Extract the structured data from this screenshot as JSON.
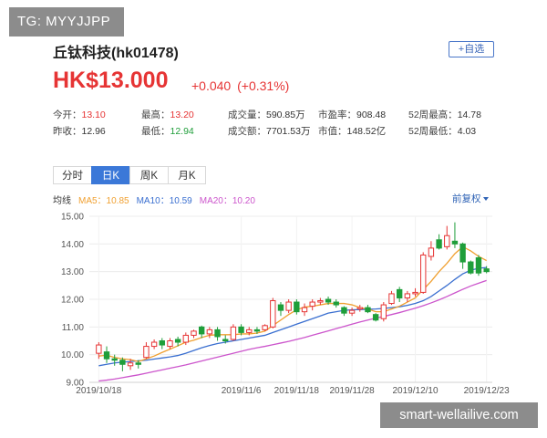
{
  "watermark_top": "TG: MYYJJPP",
  "watermark_bottom": "smart-wellailive.com",
  "stock": {
    "name": "丘钛科技(hk01478)",
    "add_label": "+自选",
    "price": "HK$13.000",
    "change": "+0.040",
    "change_pct": "(+0.31%)"
  },
  "stats": [
    [
      {
        "label": "今开：",
        "value": "13.10",
        "color": "red"
      },
      {
        "label": "最高：",
        "value": "13.20",
        "color": "red"
      },
      {
        "label": "成交量：",
        "value": "590.85万",
        "color": ""
      },
      {
        "label": "市盈率：",
        "value": "908.48",
        "color": ""
      },
      {
        "label": "52周最高：",
        "value": "14.78",
        "color": ""
      }
    ],
    [
      {
        "label": "昨收：",
        "value": "12.96",
        "color": ""
      },
      {
        "label": "最低：",
        "value": "12.94",
        "color": "green"
      },
      {
        "label": "成交额：",
        "value": "7701.53万",
        "color": ""
      },
      {
        "label": "市值：",
        "value": "148.52亿",
        "color": ""
      },
      {
        "label": "52周最低：",
        "value": "4.03",
        "color": ""
      }
    ]
  ],
  "tabs": [
    {
      "label": "分时",
      "active": false
    },
    {
      "label": "日K",
      "active": true
    },
    {
      "label": "周K",
      "active": false
    },
    {
      "label": "月K",
      "active": false
    }
  ],
  "ma": {
    "avg_label": "均线",
    "ma5": "MA5：10.85",
    "ma10": "MA10：10.59",
    "ma20": "MA20：10.20"
  },
  "adjust_label": "前复权",
  "colors": {
    "up": "#e63434",
    "down": "#1f9e3a",
    "ma5": "#f0a030",
    "ma10": "#3a6fd0",
    "ma20": "#cc55cc",
    "accent": "#3b78d8"
  },
  "chart_data": {
    "type": "candlestick",
    "ylim": [
      9.0,
      15.0
    ],
    "y_ticks": [
      "15.00",
      "14.00",
      "13.00",
      "12.00",
      "11.00",
      "10.00",
      "9.00"
    ],
    "x_ticks": [
      "2019/10/18",
      "2019/11/6",
      "2019/11/18",
      "2019/11/28",
      "2019/12/10",
      "2019/12/23"
    ],
    "candles": [
      {
        "o": 10.05,
        "c": 10.35,
        "h": 10.45,
        "l": 9.85
      },
      {
        "o": 10.1,
        "c": 9.85,
        "h": 10.3,
        "l": 9.7
      },
      {
        "o": 9.85,
        "c": 9.8,
        "h": 10.0,
        "l": 9.6
      },
      {
        "o": 9.8,
        "c": 9.65,
        "h": 9.9,
        "l": 9.4
      },
      {
        "o": 9.6,
        "c": 9.7,
        "h": 9.85,
        "l": 9.45
      },
      {
        "o": 9.7,
        "c": 9.65,
        "h": 9.8,
        "l": 9.5
      },
      {
        "o": 9.9,
        "c": 10.3,
        "h": 10.45,
        "l": 9.85
      },
      {
        "o": 10.3,
        "c": 10.45,
        "h": 10.55,
        "l": 10.2
      },
      {
        "o": 10.5,
        "c": 10.35,
        "h": 10.6,
        "l": 10.2
      },
      {
        "o": 10.3,
        "c": 10.5,
        "h": 10.6,
        "l": 10.2
      },
      {
        "o": 10.55,
        "c": 10.45,
        "h": 10.65,
        "l": 10.3
      },
      {
        "o": 10.45,
        "c": 10.7,
        "h": 10.8,
        "l": 10.35
      },
      {
        "o": 10.7,
        "c": 10.85,
        "h": 10.9,
        "l": 10.6
      },
      {
        "o": 11.0,
        "c": 10.75,
        "h": 11.05,
        "l": 10.6
      },
      {
        "o": 10.75,
        "c": 10.9,
        "h": 11.0,
        "l": 10.6
      },
      {
        "o": 10.9,
        "c": 10.65,
        "h": 11.0,
        "l": 10.5
      },
      {
        "o": 10.55,
        "c": 10.5,
        "h": 10.7,
        "l": 10.4
      },
      {
        "o": 10.55,
        "c": 11.0,
        "h": 11.1,
        "l": 10.5
      },
      {
        "o": 11.0,
        "c": 10.8,
        "h": 11.1,
        "l": 10.7
      },
      {
        "o": 10.8,
        "c": 10.9,
        "h": 11.0,
        "l": 10.7
      },
      {
        "o": 10.9,
        "c": 10.85,
        "h": 11.0,
        "l": 10.75
      },
      {
        "o": 10.9,
        "c": 11.05,
        "h": 11.1,
        "l": 10.85
      },
      {
        "o": 11.0,
        "c": 11.95,
        "h": 12.05,
        "l": 10.95
      },
      {
        "o": 11.8,
        "c": 11.6,
        "h": 11.9,
        "l": 11.4
      },
      {
        "o": 11.6,
        "c": 11.9,
        "h": 12.0,
        "l": 11.5
      },
      {
        "o": 11.9,
        "c": 11.55,
        "h": 12.0,
        "l": 11.45
      },
      {
        "o": 11.55,
        "c": 11.7,
        "h": 11.85,
        "l": 11.4
      },
      {
        "o": 11.75,
        "c": 11.9,
        "h": 12.0,
        "l": 11.6
      },
      {
        "o": 11.9,
        "c": 11.95,
        "h": 12.05,
        "l": 11.8
      },
      {
        "o": 12.0,
        "c": 11.9,
        "h": 12.1,
        "l": 11.8
      },
      {
        "o": 11.9,
        "c": 11.8,
        "h": 12.0,
        "l": 11.7
      },
      {
        "o": 11.7,
        "c": 11.5,
        "h": 11.75,
        "l": 11.4
      },
      {
        "o": 11.5,
        "c": 11.6,
        "h": 11.7,
        "l": 11.4
      },
      {
        "o": 11.65,
        "c": 11.7,
        "h": 11.8,
        "l": 11.55
      },
      {
        "o": 11.7,
        "c": 11.55,
        "h": 11.8,
        "l": 11.5
      },
      {
        "o": 11.45,
        "c": 11.25,
        "h": 11.5,
        "l": 11.2
      },
      {
        "o": 11.3,
        "c": 11.8,
        "h": 11.9,
        "l": 11.2
      },
      {
        "o": 11.85,
        "c": 12.2,
        "h": 12.3,
        "l": 11.8
      },
      {
        "o": 12.35,
        "c": 12.05,
        "h": 12.45,
        "l": 11.9
      },
      {
        "o": 12.05,
        "c": 12.2,
        "h": 12.3,
        "l": 11.9
      },
      {
        "o": 12.2,
        "c": 12.25,
        "h": 12.4,
        "l": 12.1
      },
      {
        "o": 12.25,
        "c": 13.6,
        "h": 13.7,
        "l": 12.2
      },
      {
        "o": 13.55,
        "c": 13.85,
        "h": 14.1,
        "l": 13.4
      },
      {
        "o": 14.15,
        "c": 13.85,
        "h": 14.35,
        "l": 13.8
      },
      {
        "o": 13.9,
        "c": 14.3,
        "h": 14.65,
        "l": 13.8
      },
      {
        "o": 14.1,
        "c": 14.0,
        "h": 14.78,
        "l": 13.85
      },
      {
        "o": 14.0,
        "c": 13.35,
        "h": 14.05,
        "l": 13.1
      },
      {
        "o": 13.35,
        "c": 12.95,
        "h": 13.4,
        "l": 12.9
      },
      {
        "o": 13.5,
        "c": 12.95,
        "h": 13.6,
        "l": 12.85
      },
      {
        "o": 13.1,
        "c": 13.0,
        "h": 13.2,
        "l": 12.94
      }
    ],
    "ma5": [
      9.95,
      9.98,
      9.9,
      9.85,
      9.82,
      9.75,
      9.85,
      9.95,
      10.08,
      10.2,
      10.32,
      10.45,
      10.52,
      10.62,
      10.7,
      10.72,
      10.72,
      10.72,
      10.75,
      10.75,
      10.78,
      10.85,
      11.05,
      11.25,
      11.45,
      11.62,
      11.72,
      11.75,
      11.8,
      11.85,
      11.85,
      11.85,
      11.8,
      11.7,
      11.65,
      11.55,
      11.55,
      11.65,
      11.75,
      11.9,
      12.05,
      12.35,
      12.65,
      13.0,
      13.3,
      13.65,
      13.9,
      13.75,
      13.55,
      13.4
    ],
    "ma10": [
      9.6,
      9.65,
      9.7,
      9.73,
      9.75,
      9.78,
      9.8,
      9.84,
      9.88,
      9.92,
      9.97,
      10.05,
      10.15,
      10.25,
      10.33,
      10.4,
      10.45,
      10.5,
      10.55,
      10.6,
      10.65,
      10.7,
      10.8,
      10.9,
      11.0,
      11.1,
      11.2,
      11.3,
      11.4,
      11.5,
      11.55,
      11.6,
      11.62,
      11.63,
      11.64,
      11.65,
      11.67,
      11.7,
      11.73,
      11.78,
      11.85,
      11.95,
      12.1,
      12.3,
      12.5,
      12.72,
      12.92,
      13.05,
      13.12,
      13.15
    ],
    "ma20": [
      9.05,
      9.08,
      9.12,
      9.17,
      9.22,
      9.27,
      9.33,
      9.39,
      9.45,
      9.51,
      9.57,
      9.63,
      9.7,
      9.77,
      9.84,
      9.91,
      9.98,
      10.05,
      10.12,
      10.19,
      10.25,
      10.3,
      10.36,
      10.42,
      10.48,
      10.55,
      10.62,
      10.7,
      10.78,
      10.86,
      10.94,
      11.02,
      11.1,
      11.18,
      11.25,
      11.32,
      11.38,
      11.45,
      11.52,
      11.6,
      11.68,
      11.77,
      11.87,
      11.98,
      12.1,
      12.23,
      12.36,
      12.48,
      12.58,
      12.68
    ]
  }
}
